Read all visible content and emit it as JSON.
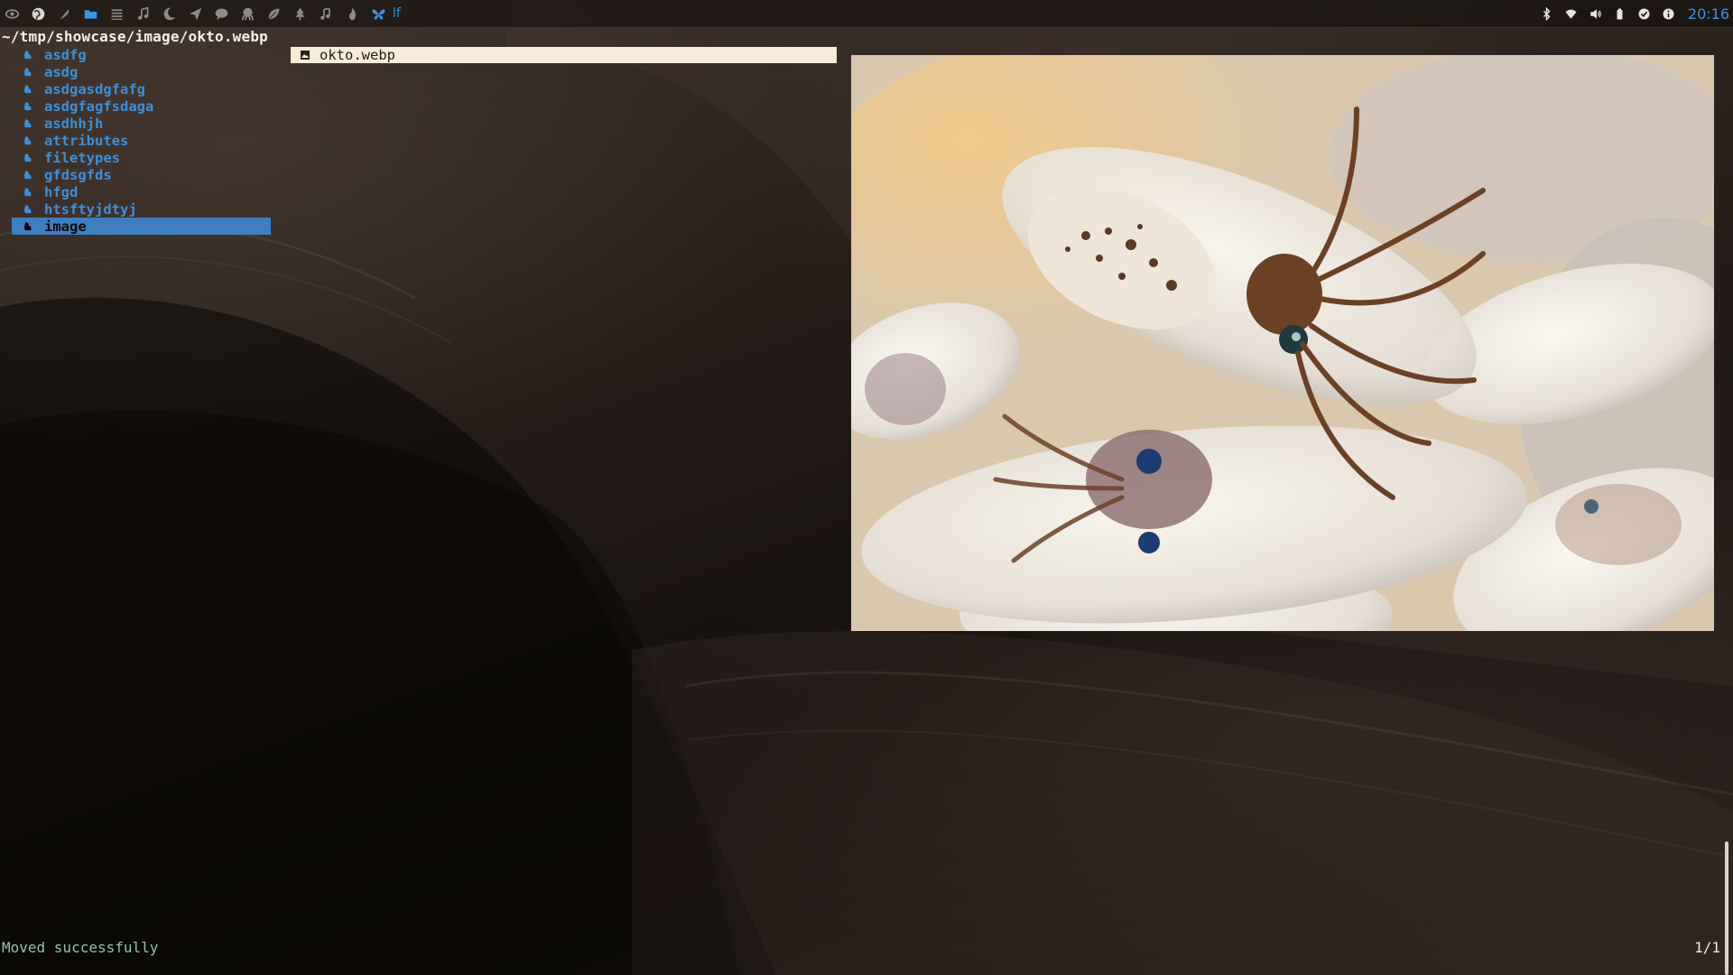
{
  "topbar": {
    "icons": [
      "eye-icon",
      "globe-icon",
      "feather-icon",
      "folder-icon",
      "list-icon",
      "music-icon",
      "moon-icon",
      "paper-plane-icon",
      "chat-icon",
      "octopus-icon",
      "leaf-icon",
      "tree-icon",
      "notes-icon",
      "fire-icon"
    ],
    "active_window": {
      "icon": "butterfly-icon",
      "title": "lf"
    },
    "tray": [
      "bluetooth-icon",
      "network-icon",
      "volume-icon",
      "battery-icon",
      "check-icon",
      "info-icon"
    ],
    "clock": "20:16",
    "accent": "#3a93e8"
  },
  "file_manager": {
    "path": "~/tmp/showcase/image/okto.webp",
    "directories": [
      {
        "name": "asdfg"
      },
      {
        "name": "asdg"
      },
      {
        "name": "asdgasdgfafg"
      },
      {
        "name": "asdgfagfsdaga"
      },
      {
        "name": "asdhhjh"
      },
      {
        "name": "attributes"
      },
      {
        "name": "filetypes"
      },
      {
        "name": "gfdsgfds"
      },
      {
        "name": "hfgd"
      },
      {
        "name": "htsftyjdtyj"
      },
      {
        "name": "image"
      }
    ],
    "selected_directory": "image",
    "files": [
      {
        "name": "okto.webp"
      }
    ],
    "status_message": "Moved successfully",
    "position": "1/1",
    "dir_color": "#3d8fd9",
    "selection_color": "#3f7fc0",
    "status_color": "#8fc7a0"
  }
}
